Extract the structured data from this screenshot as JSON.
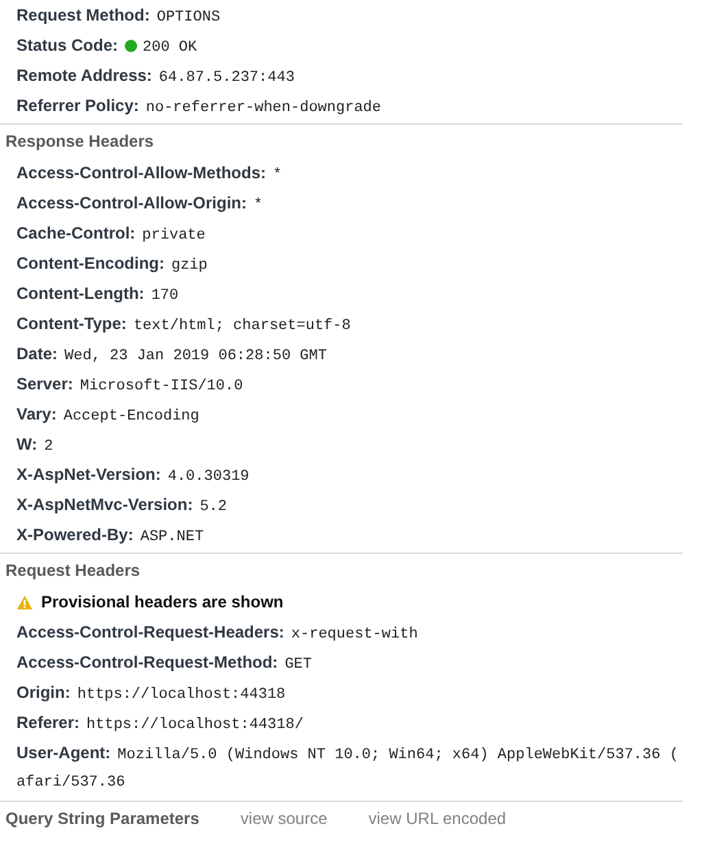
{
  "general": [
    {
      "label": "Request Method:",
      "value": "OPTIONS"
    },
    {
      "label": "Status Code:",
      "value": "200 OK",
      "color": "#22aa22"
    },
    {
      "label": "Remote Address:",
      "value": "64.87.5.237:443"
    },
    {
      "label": "Referrer Policy:",
      "value": "no-referrer-when-downgrade"
    }
  ],
  "response_headers": {
    "title": "Response Headers",
    "rows": [
      {
        "label": "Access-Control-Allow-Methods:",
        "value": "*"
      },
      {
        "label": "Access-Control-Allow-Origin:",
        "value": "*"
      },
      {
        "label": "Cache-Control:",
        "value": "private"
      },
      {
        "label": "Content-Encoding:",
        "value": "gzip"
      },
      {
        "label": "Content-Length:",
        "value": "170"
      },
      {
        "label": "Content-Type:",
        "value": "text/html; charset=utf-8"
      },
      {
        "label": "Date:",
        "value": "Wed, 23 Jan 2019 06:28:50 GMT"
      },
      {
        "label": "Server:",
        "value": "Microsoft-IIS/10.0"
      },
      {
        "label": "Vary:",
        "value": "Accept-Encoding"
      },
      {
        "label": "W:",
        "value": "2"
      },
      {
        "label": "X-AspNet-Version:",
        "value": "4.0.30319"
      },
      {
        "label": "X-AspNetMvc-Version:",
        "value": "5.2"
      },
      {
        "label": "X-Powered-By:",
        "value": "ASP.NET"
      }
    ]
  },
  "request_headers": {
    "title": "Request Headers",
    "warning": "Provisional headers are shown",
    "rows": [
      {
        "label": "Access-Control-Request-Headers:",
        "value": "x-request-with"
      },
      {
        "label": "Access-Control-Request-Method:",
        "value": "GET"
      },
      {
        "label": "Origin:",
        "value": "https://localhost:44318"
      },
      {
        "label": "Referer:",
        "value": "https://localhost:44318/"
      },
      {
        "label": "User-Agent:",
        "value": "Mozilla/5.0 (Windows NT 10.0; Win64; x64) AppleWebKit/537.36 (",
        "wrapped_value": "afari/537.36"
      }
    ]
  },
  "query_string": {
    "title": "Query String Parameters",
    "links": [
      "view source",
      "view URL encoded"
    ]
  }
}
